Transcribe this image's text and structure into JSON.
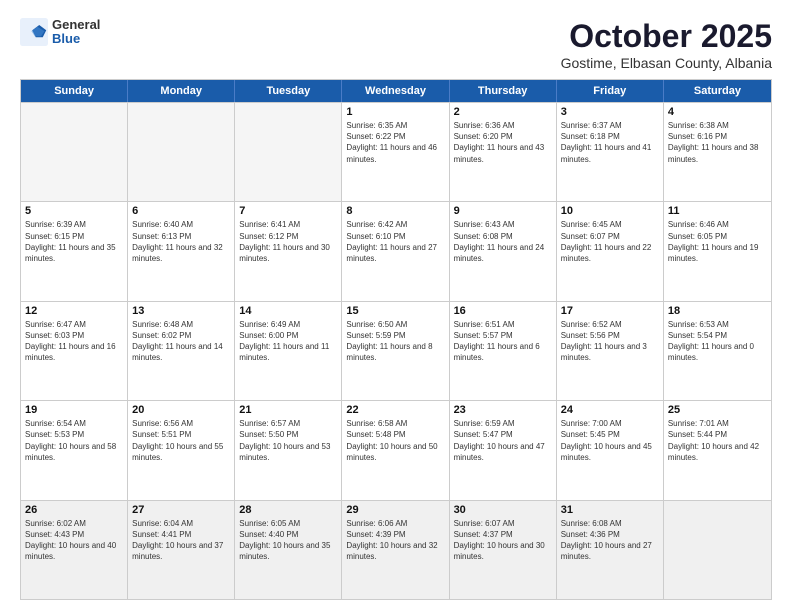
{
  "logo": {
    "general": "General",
    "blue": "Blue"
  },
  "header": {
    "month": "October 2025",
    "location": "Gostime, Elbasan County, Albania"
  },
  "weekdays": [
    "Sunday",
    "Monday",
    "Tuesday",
    "Wednesday",
    "Thursday",
    "Friday",
    "Saturday"
  ],
  "rows": [
    [
      {
        "day": "",
        "info": ""
      },
      {
        "day": "",
        "info": ""
      },
      {
        "day": "",
        "info": ""
      },
      {
        "day": "1",
        "info": "Sunrise: 6:35 AM\nSunset: 6:22 PM\nDaylight: 11 hours and 46 minutes."
      },
      {
        "day": "2",
        "info": "Sunrise: 6:36 AM\nSunset: 6:20 PM\nDaylight: 11 hours and 43 minutes."
      },
      {
        "day": "3",
        "info": "Sunrise: 6:37 AM\nSunset: 6:18 PM\nDaylight: 11 hours and 41 minutes."
      },
      {
        "day": "4",
        "info": "Sunrise: 6:38 AM\nSunset: 6:16 PM\nDaylight: 11 hours and 38 minutes."
      }
    ],
    [
      {
        "day": "5",
        "info": "Sunrise: 6:39 AM\nSunset: 6:15 PM\nDaylight: 11 hours and 35 minutes."
      },
      {
        "day": "6",
        "info": "Sunrise: 6:40 AM\nSunset: 6:13 PM\nDaylight: 11 hours and 32 minutes."
      },
      {
        "day": "7",
        "info": "Sunrise: 6:41 AM\nSunset: 6:12 PM\nDaylight: 11 hours and 30 minutes."
      },
      {
        "day": "8",
        "info": "Sunrise: 6:42 AM\nSunset: 6:10 PM\nDaylight: 11 hours and 27 minutes."
      },
      {
        "day": "9",
        "info": "Sunrise: 6:43 AM\nSunset: 6:08 PM\nDaylight: 11 hours and 24 minutes."
      },
      {
        "day": "10",
        "info": "Sunrise: 6:45 AM\nSunset: 6:07 PM\nDaylight: 11 hours and 22 minutes."
      },
      {
        "day": "11",
        "info": "Sunrise: 6:46 AM\nSunset: 6:05 PM\nDaylight: 11 hours and 19 minutes."
      }
    ],
    [
      {
        "day": "12",
        "info": "Sunrise: 6:47 AM\nSunset: 6:03 PM\nDaylight: 11 hours and 16 minutes."
      },
      {
        "day": "13",
        "info": "Sunrise: 6:48 AM\nSunset: 6:02 PM\nDaylight: 11 hours and 14 minutes."
      },
      {
        "day": "14",
        "info": "Sunrise: 6:49 AM\nSunset: 6:00 PM\nDaylight: 11 hours and 11 minutes."
      },
      {
        "day": "15",
        "info": "Sunrise: 6:50 AM\nSunset: 5:59 PM\nDaylight: 11 hours and 8 minutes."
      },
      {
        "day": "16",
        "info": "Sunrise: 6:51 AM\nSunset: 5:57 PM\nDaylight: 11 hours and 6 minutes."
      },
      {
        "day": "17",
        "info": "Sunrise: 6:52 AM\nSunset: 5:56 PM\nDaylight: 11 hours and 3 minutes."
      },
      {
        "day": "18",
        "info": "Sunrise: 6:53 AM\nSunset: 5:54 PM\nDaylight: 11 hours and 0 minutes."
      }
    ],
    [
      {
        "day": "19",
        "info": "Sunrise: 6:54 AM\nSunset: 5:53 PM\nDaylight: 10 hours and 58 minutes."
      },
      {
        "day": "20",
        "info": "Sunrise: 6:56 AM\nSunset: 5:51 PM\nDaylight: 10 hours and 55 minutes."
      },
      {
        "day": "21",
        "info": "Sunrise: 6:57 AM\nSunset: 5:50 PM\nDaylight: 10 hours and 53 minutes."
      },
      {
        "day": "22",
        "info": "Sunrise: 6:58 AM\nSunset: 5:48 PM\nDaylight: 10 hours and 50 minutes."
      },
      {
        "day": "23",
        "info": "Sunrise: 6:59 AM\nSunset: 5:47 PM\nDaylight: 10 hours and 47 minutes."
      },
      {
        "day": "24",
        "info": "Sunrise: 7:00 AM\nSunset: 5:45 PM\nDaylight: 10 hours and 45 minutes."
      },
      {
        "day": "25",
        "info": "Sunrise: 7:01 AM\nSunset: 5:44 PM\nDaylight: 10 hours and 42 minutes."
      }
    ],
    [
      {
        "day": "26",
        "info": "Sunrise: 6:02 AM\nSunset: 4:43 PM\nDaylight: 10 hours and 40 minutes."
      },
      {
        "day": "27",
        "info": "Sunrise: 6:04 AM\nSunset: 4:41 PM\nDaylight: 10 hours and 37 minutes."
      },
      {
        "day": "28",
        "info": "Sunrise: 6:05 AM\nSunset: 4:40 PM\nDaylight: 10 hours and 35 minutes."
      },
      {
        "day": "29",
        "info": "Sunrise: 6:06 AM\nSunset: 4:39 PM\nDaylight: 10 hours and 32 minutes."
      },
      {
        "day": "30",
        "info": "Sunrise: 6:07 AM\nSunset: 4:37 PM\nDaylight: 10 hours and 30 minutes."
      },
      {
        "day": "31",
        "info": "Sunrise: 6:08 AM\nSunset: 4:36 PM\nDaylight: 10 hours and 27 minutes."
      },
      {
        "day": "",
        "info": ""
      }
    ]
  ]
}
